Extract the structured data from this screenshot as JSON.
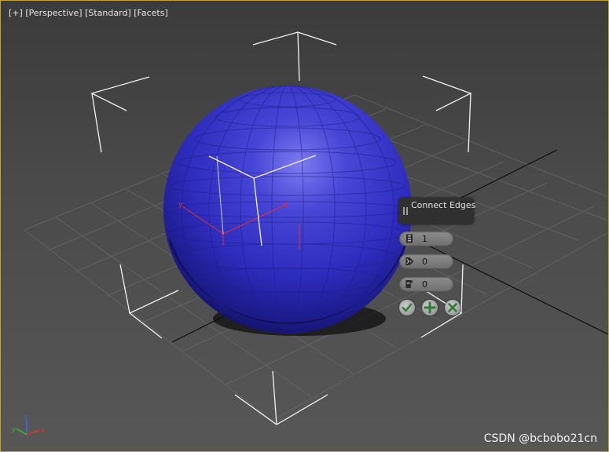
{
  "viewport": {
    "labels": {
      "plus": "[+]",
      "view": "[Perspective]",
      "shading_mode": "[Standard]",
      "display": "[Facets]"
    },
    "active_border_color": "#c9a227"
  },
  "object": {
    "color": "#2b29b4"
  },
  "caddy": {
    "title": "Connect Edges",
    "segments": {
      "icon": "segments-icon",
      "value": "1"
    },
    "pinch": {
      "icon": "pinch-icon",
      "value": "0"
    },
    "slide": {
      "icon": "slide-icon",
      "value": "0"
    },
    "buttons": {
      "ok": "check-icon",
      "apply": "plus-icon",
      "cancel": "cancel-icon"
    }
  },
  "axis_gizmo": {
    "x": "x",
    "y": "y",
    "z": "z"
  },
  "watermark": "CSDN @bcbobo21cn"
}
